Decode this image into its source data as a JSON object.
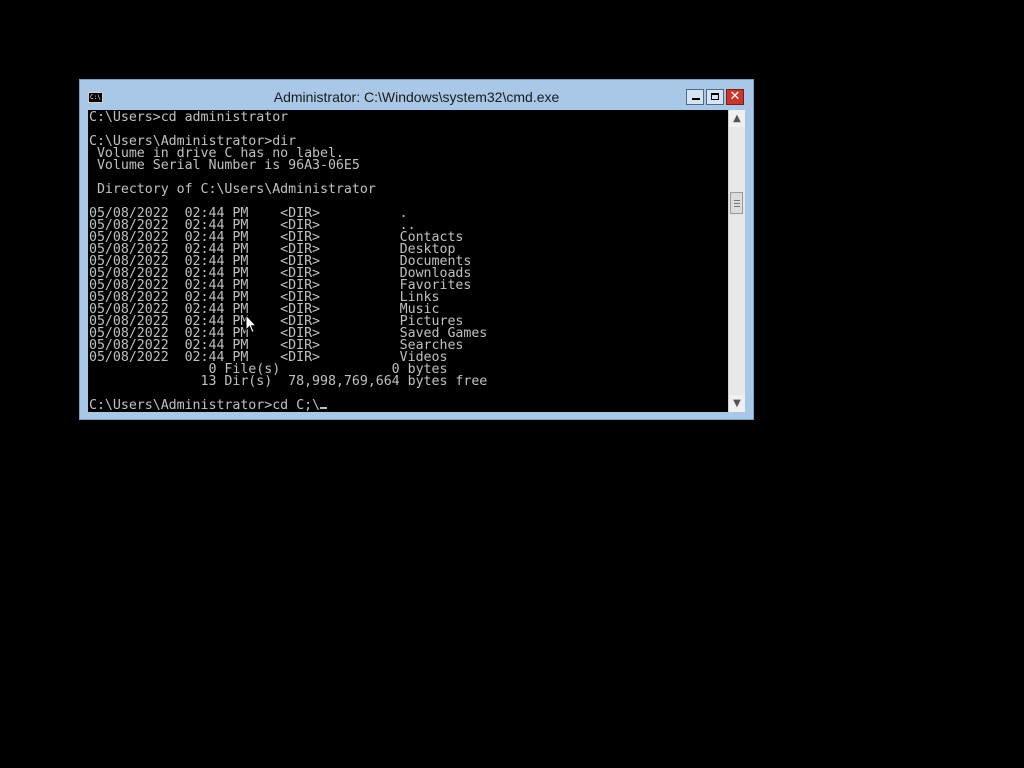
{
  "window": {
    "title": "Administrator: C:\\Windows\\system32\\cmd.exe",
    "app_icon_label": "C:\\"
  },
  "controls": {
    "minimize_icon": "minimize-icon",
    "maximize_icon": "maximize-icon",
    "close_icon": "close-icon",
    "close_glyph": "✕"
  },
  "console": {
    "lines": [
      "C:\\Users>cd administrator",
      "",
      "C:\\Users\\Administrator>dir",
      " Volume in drive C has no label.",
      " Volume Serial Number is 96A3-06E5",
      "",
      " Directory of C:\\Users\\Administrator",
      "",
      "05/08/2022  02:44 PM    <DIR>          .",
      "05/08/2022  02:44 PM    <DIR>          ..",
      "05/08/2022  02:44 PM    <DIR>          Contacts",
      "05/08/2022  02:44 PM    <DIR>          Desktop",
      "05/08/2022  02:44 PM    <DIR>          Documents",
      "05/08/2022  02:44 PM    <DIR>          Downloads",
      "05/08/2022  02:44 PM    <DIR>          Favorites",
      "05/08/2022  02:44 PM    <DIR>          Links",
      "05/08/2022  02:44 PM    <DIR>          Music",
      "05/08/2022  02:44 PM    <DIR>          Pictures",
      "05/08/2022  02:44 PM    <DIR>          Saved Games",
      "05/08/2022  02:44 PM    <DIR>          Searches",
      "05/08/2022  02:44 PM    <DIR>          Videos",
      "               0 File(s)              0 bytes",
      "              13 Dir(s)  78,998,769,664 bytes free",
      ""
    ],
    "current_prompt": "C:\\Users\\Administrator>cd C;\\"
  },
  "scrollbar": {
    "up_glyph": "▲",
    "down_glyph": "▼"
  },
  "colors": {
    "desktop_bg": "#000000",
    "window_frame": "#a9c8e8",
    "console_bg": "#000000",
    "console_fg": "#c0c0c0",
    "close_button": "#c7382c"
  }
}
